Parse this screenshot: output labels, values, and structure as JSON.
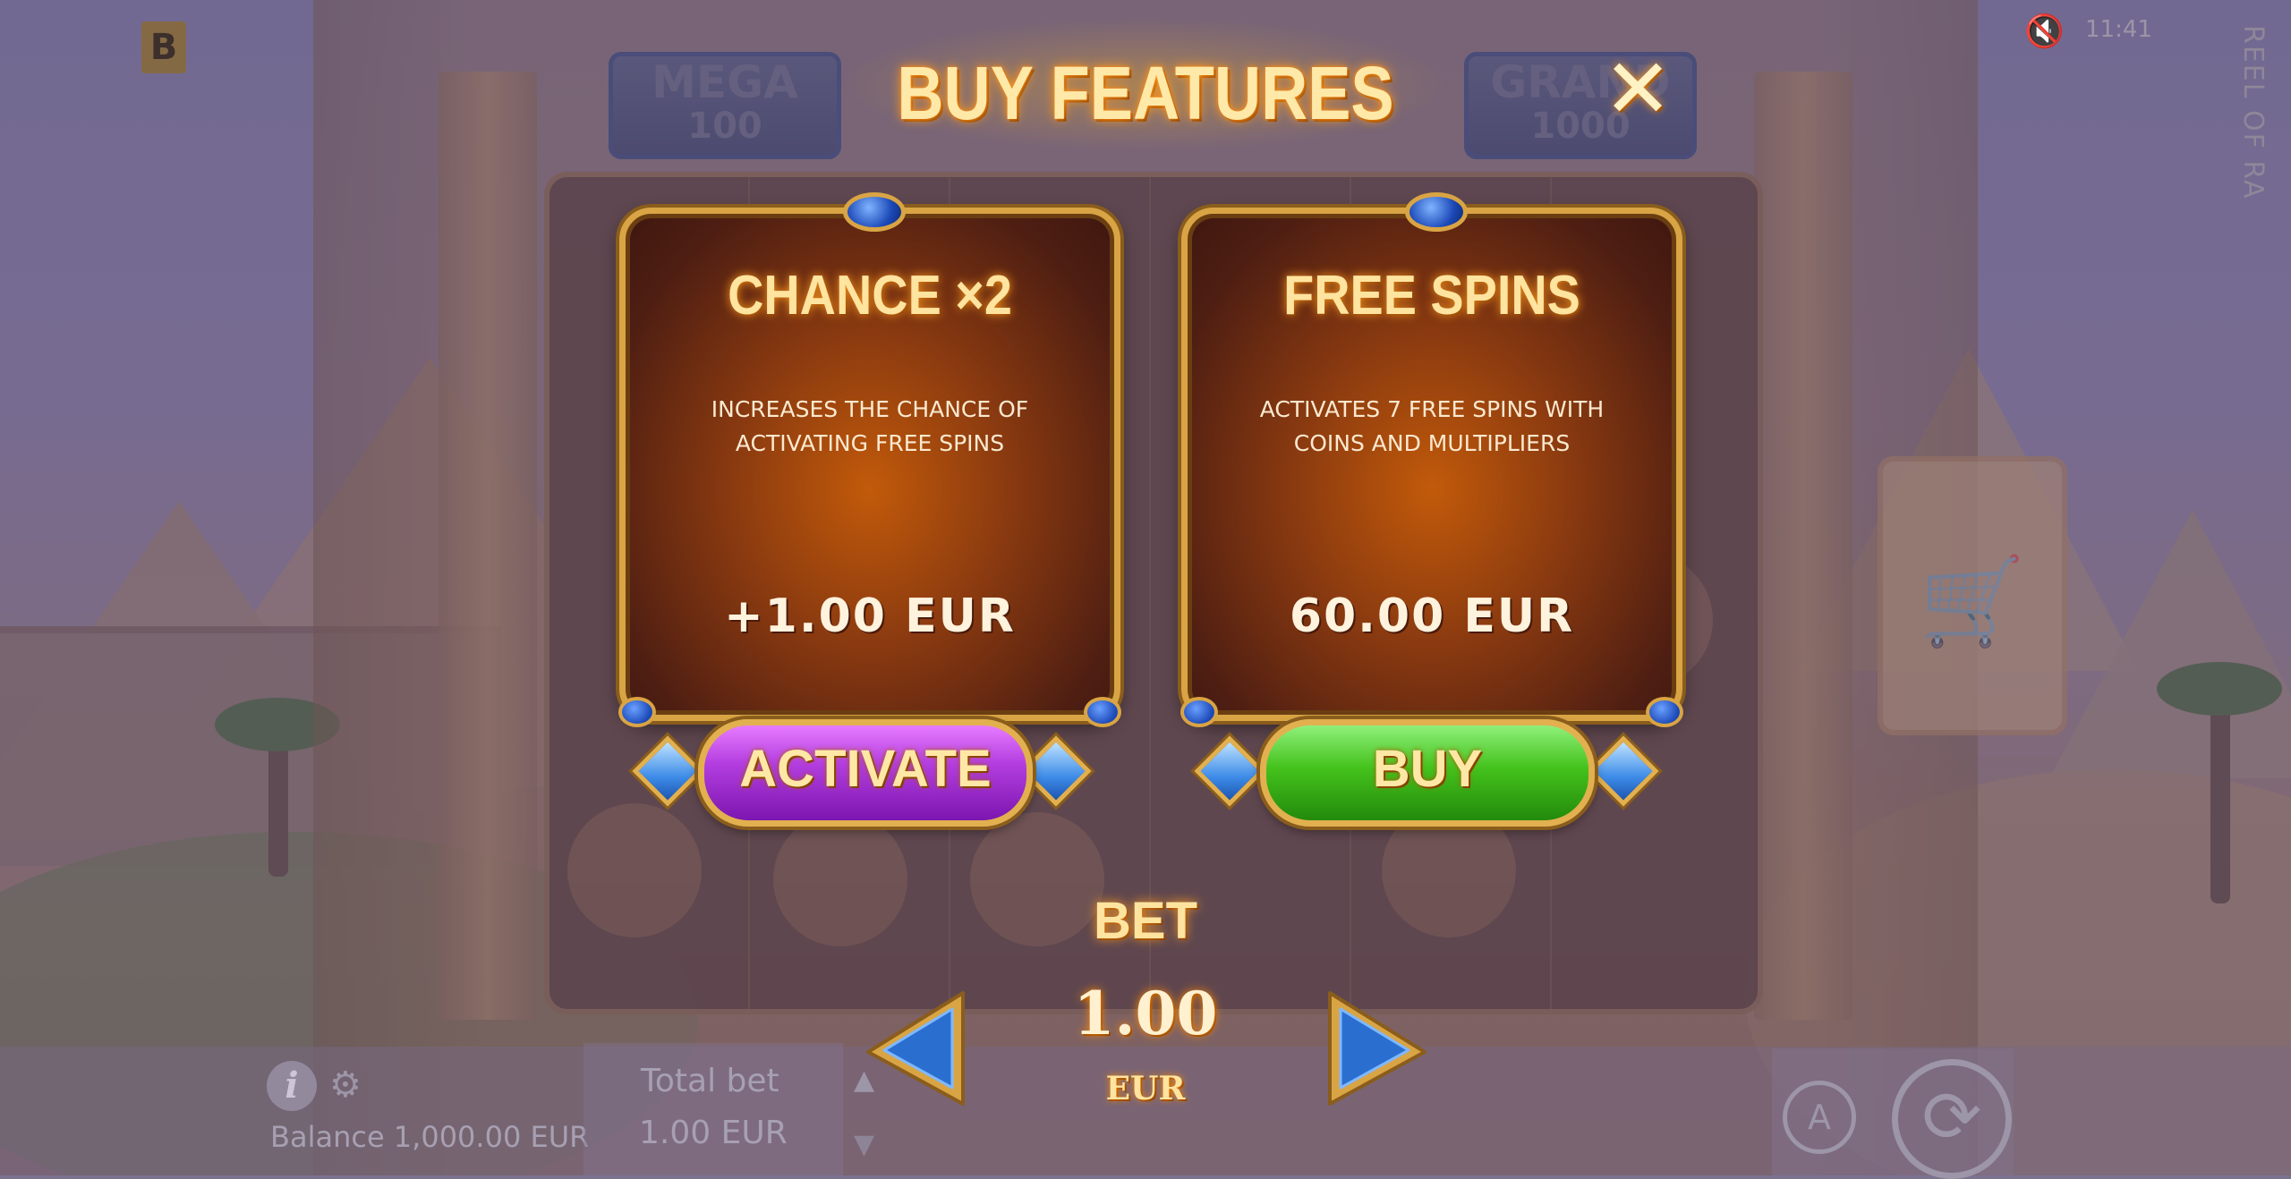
{
  "top_bar": {
    "brand_letter": "B",
    "mute_icon": "speaker-muted-icon",
    "clock": "11:41",
    "game_title": "REEL OF RA"
  },
  "jackpots": [
    {
      "name": "MEGA",
      "value": "100"
    },
    {
      "name": "GRAND",
      "value": "1000"
    }
  ],
  "modal": {
    "title": "BUY FEATURES",
    "close_icon": "close-icon",
    "cards": [
      {
        "title": "CHANCE ×2",
        "description_line1": "INCREASES THE CHANCE OF",
        "description_line2": "ACTIVATING FREE SPINS",
        "price": "+1.00  EUR",
        "button_label": "ACTIVATE",
        "button_color": "#b43ee0"
      },
      {
        "title": "FREE SPINS",
        "description_line1": "ACTIVATES 7 FREE SPINS WITH",
        "description_line2": "COINS AND MULTIPLIERS",
        "price": "60.00  EUR",
        "button_label": "BUY",
        "button_color": "#44c21c"
      }
    ],
    "bet": {
      "label": "BET",
      "value": "1.00",
      "currency": "EUR"
    }
  },
  "bottom_bar": {
    "balance": "Balance 1,000.00 EUR",
    "total_bet_label": "Total bet",
    "total_bet_value": "1.00 EUR",
    "auto_label": "A"
  },
  "colors": {
    "accent_gold": "#d9a444",
    "title_glow": "#ff9a1e",
    "activate_purple": "#b43ee0",
    "buy_green": "#44c21c",
    "gem_blue": "#1c49b8"
  }
}
